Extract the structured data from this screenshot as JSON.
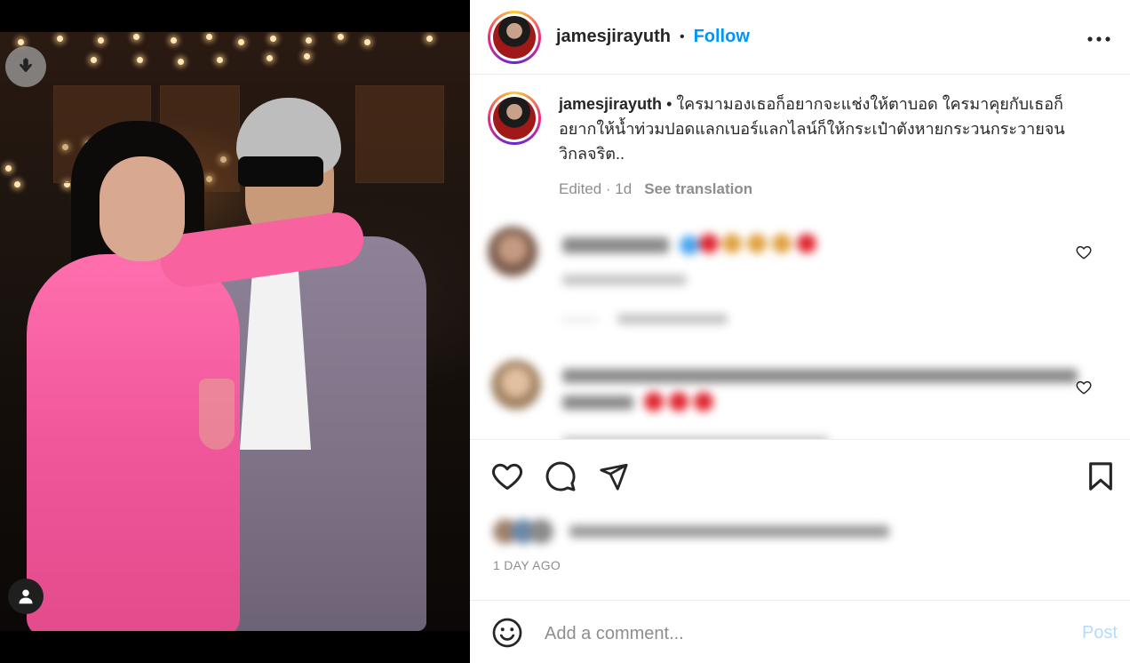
{
  "post": {
    "username": "jamesjirayuth",
    "dot": "•",
    "follow_label": "Follow",
    "more_label": "•••"
  },
  "caption": {
    "username": "jamesjirayuth",
    "separator": " • ",
    "text": "ใครมามองเธอก็อยากจะแช่งให้ตาบอด ใครมาคุยกับเธอก็อยากให้น้ำท่วมปอดแลกเบอร์แลกไลน์ก็ให้กระเป๋าตังหายกระวนกระวายจนวิกลจริต..",
    "meta": "Edited · 1d",
    "see_translation": "See translation"
  },
  "actions": {
    "date": "1 DAY AGO"
  },
  "add_comment": {
    "placeholder": "Add a comment...",
    "post_label": "Post"
  },
  "colors": {
    "follow": "#0095f6",
    "post_disabled": "#b3dbff",
    "text": "#262626",
    "meta": "#8e8e8e",
    "heart_red": "#e0242f"
  }
}
